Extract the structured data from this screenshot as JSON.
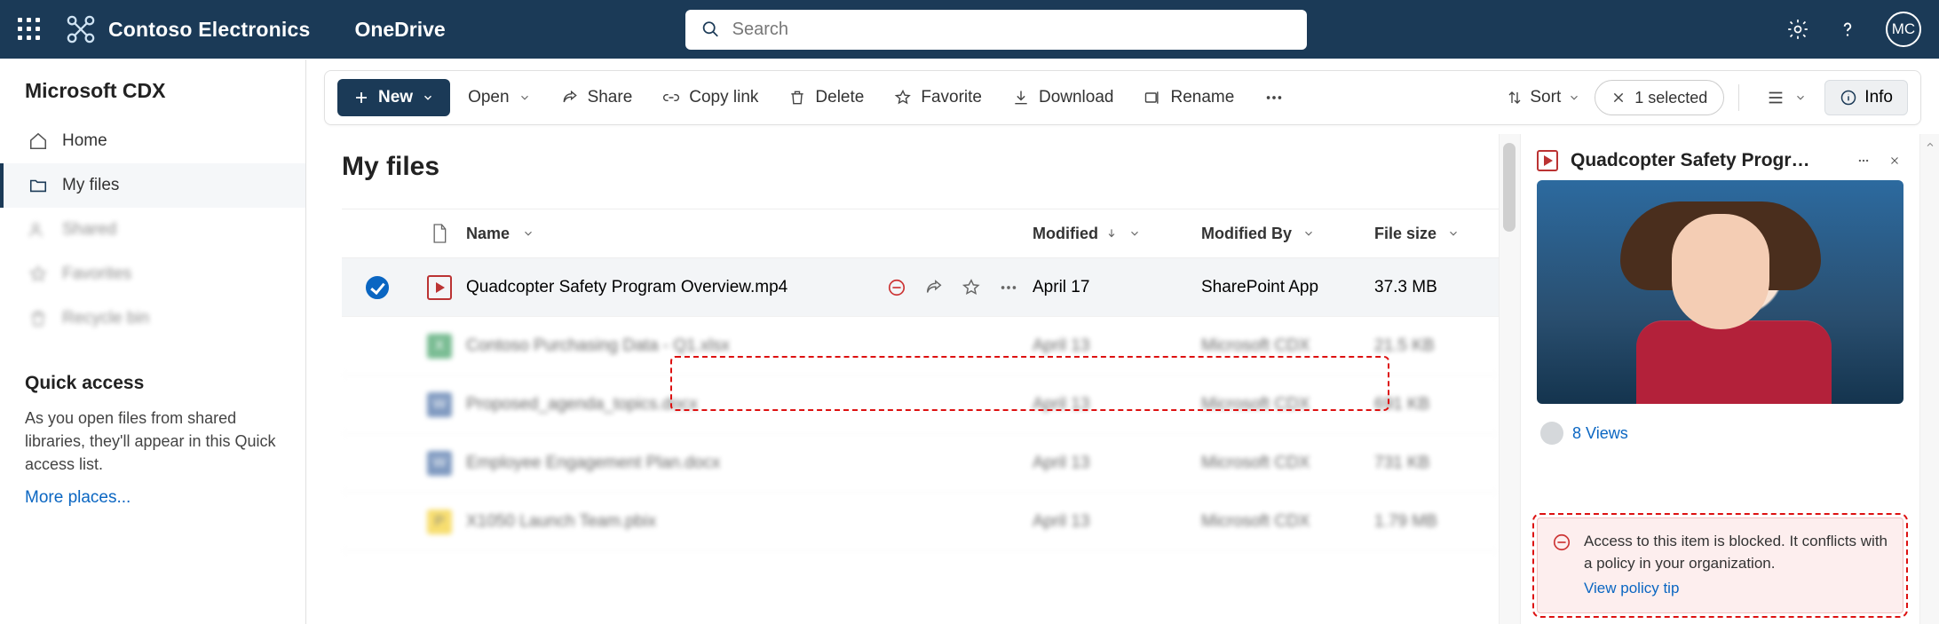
{
  "appbar": {
    "brand": "Contoso Electronics",
    "app": "OneDrive",
    "search_placeholder": "Search",
    "avatar": "MC"
  },
  "sidebar": {
    "site_title": "Microsoft CDX",
    "items": [
      {
        "icon": "home-icon",
        "label": "Home"
      },
      {
        "icon": "folder-icon",
        "label": "My files"
      },
      {
        "icon": "people-icon",
        "label": "Shared"
      },
      {
        "icon": "star-icon",
        "label": "Favorites"
      },
      {
        "icon": "trash-icon",
        "label": "Recycle bin"
      }
    ],
    "quick_heading": "Quick access",
    "quick_text": "As you open files from shared libraries, they'll appear in this Quick access list.",
    "more_link": "More places..."
  },
  "toolbar": {
    "new_label": "New",
    "open": "Open",
    "share": "Share",
    "copylink": "Copy link",
    "delete": "Delete",
    "favorite": "Favorite",
    "download": "Download",
    "rename": "Rename",
    "sort": "Sort",
    "selected": "1 selected",
    "info": "Info"
  },
  "list": {
    "heading": "My files",
    "columns": {
      "name": "Name",
      "modified": "Modified",
      "modified_by": "Modified By",
      "size": "File size"
    },
    "rows": [
      {
        "name": "Quadcopter Safety Program Overview.mp4",
        "modified": "April 17",
        "by": "SharePoint App",
        "size": "37.3 MB",
        "selected": true,
        "blocked": true,
        "type": "video"
      },
      {
        "name": "Contoso Purchasing Data - Q1.xlsx",
        "modified": "April 13",
        "by": "Microsoft CDX",
        "size": "21.5 KB",
        "type": "xlsx"
      },
      {
        "name": "Proposed_agenda_topics.docx",
        "modified": "April 13",
        "by": "Microsoft CDX",
        "size": "691 KB",
        "type": "docx"
      },
      {
        "name": "Employee Engagement Plan.docx",
        "modified": "April 13",
        "by": "Microsoft CDX",
        "size": "731 KB",
        "type": "docx"
      },
      {
        "name": "X1050 Launch Team.pbix",
        "modified": "April 13",
        "by": "Microsoft CDX",
        "size": "1.79 MB",
        "type": "pbix"
      }
    ]
  },
  "panel": {
    "title": "Quadcopter Safety Progr…",
    "views": "8 Views",
    "policy_text": "Access to this item is blocked. It conflicts with a policy in your organization.",
    "policy_link": "View policy tip"
  }
}
